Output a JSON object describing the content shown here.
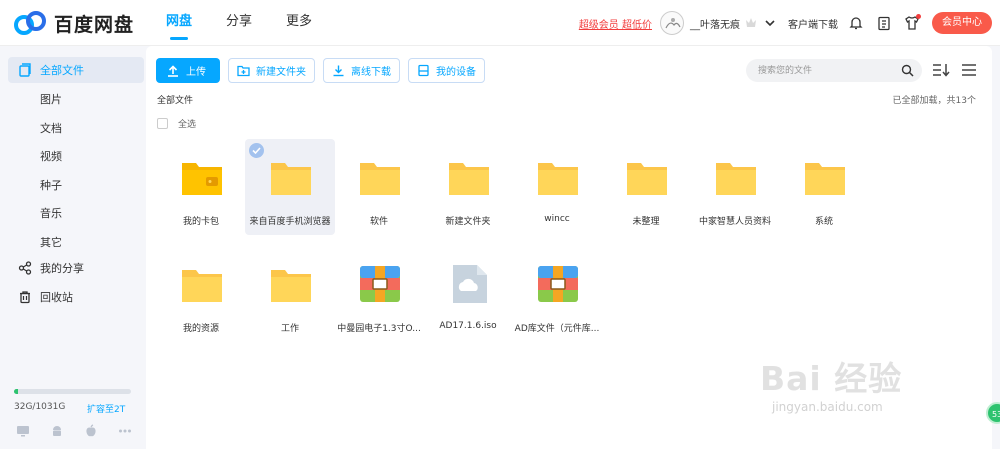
{
  "app": {
    "logo_text": "百度网盘"
  },
  "nav": {
    "tabs": [
      "网盘",
      "分享",
      "更多"
    ],
    "active": 0
  },
  "header": {
    "promo": "超级会员 超低价",
    "username": "__叶落无痕",
    "service": "客户端下载",
    "vip_center": "会员中心"
  },
  "sidebar": {
    "all_files": "全部文件",
    "categories": [
      "图片",
      "文档",
      "视频",
      "种子",
      "音乐",
      "其它"
    ],
    "my_share": "我的分享",
    "recycle": "回收站",
    "storage_used": "32G/1031G",
    "storage_fraction": 0.031,
    "expand": "扩容至2T"
  },
  "toolbar": {
    "upload": "上传",
    "new_folder": "新建文件夹",
    "offline": "离线下载",
    "devices": "我的设备",
    "search_placeholder": "搜索您的文件"
  },
  "main": {
    "breadcrumb": "全部文件",
    "loaded_text": "已全部加载，共13个",
    "select_all": "全选"
  },
  "files": [
    {
      "name": "我的卡包",
      "icon": "wallet-folder-icon"
    },
    {
      "name": "来自百度手机浏览器",
      "icon": "folder-icon",
      "selected": true
    },
    {
      "name": "软件",
      "icon": "folder-icon"
    },
    {
      "name": "新建文件夹",
      "icon": "folder-icon"
    },
    {
      "name": "wincc",
      "icon": "folder-icon"
    },
    {
      "name": "未整理",
      "icon": "folder-icon"
    },
    {
      "name": "中家智慧人员资料",
      "icon": "folder-icon"
    },
    {
      "name": "系统",
      "icon": "folder-icon"
    },
    {
      "name": "我的资源",
      "icon": "folder-icon"
    },
    {
      "name": "工作",
      "icon": "folder-icon"
    },
    {
      "name": "中曼园电子1.3寸O...",
      "icon": "archive-icon"
    },
    {
      "name": "AD17.1.6.iso",
      "icon": "iso-file-icon"
    },
    {
      "name": "AD库文件（元件库...",
      "icon": "archive-icon"
    }
  ],
  "watermark": {
    "big": "Bai 经验",
    "small": "jingyan.baidu.com"
  },
  "float_badge": "53",
  "colors": {
    "accent": "#06a7ff",
    "folder": "#ffd659",
    "vip": "#f95a4a",
    "storage": "#2dc36f"
  }
}
